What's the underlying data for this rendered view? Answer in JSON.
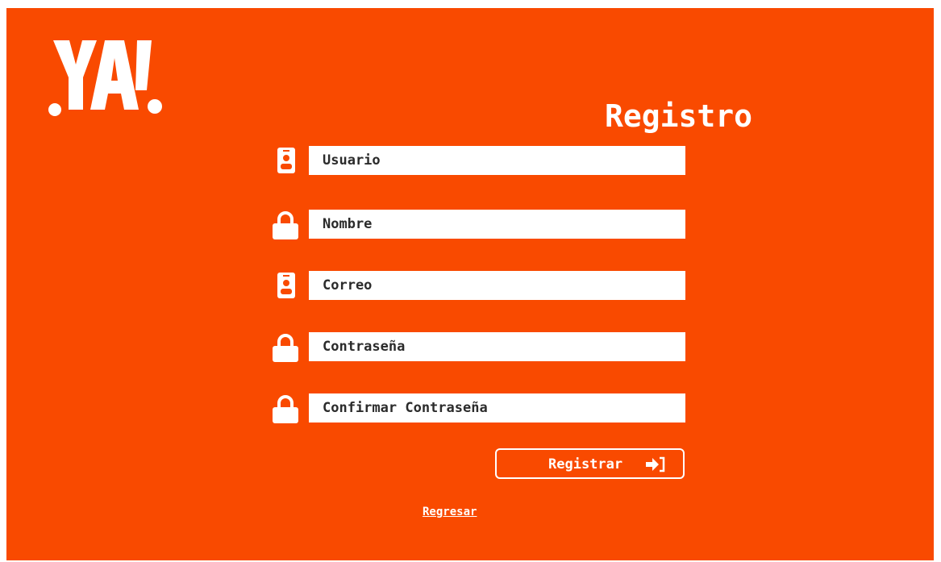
{
  "brand": {
    "logo_text": "YA!"
  },
  "form": {
    "title": "Registro",
    "fields": [
      {
        "icon": "user-badge-icon",
        "placeholder": "Usuario"
      },
      {
        "icon": "lock-icon",
        "placeholder": "Nombre"
      },
      {
        "icon": "user-badge-icon",
        "placeholder": "Correo"
      },
      {
        "icon": "lock-icon",
        "placeholder": "Contraseña"
      },
      {
        "icon": "lock-icon",
        "placeholder": "Confirmar Contraseña"
      }
    ],
    "submit_label": "Registrar",
    "submit_icon": "sign-in-icon",
    "back_link": "Regresar"
  },
  "colors": {
    "background": "#f94a00",
    "foreground": "#ffffff",
    "input_text": "#2b2b2b"
  }
}
